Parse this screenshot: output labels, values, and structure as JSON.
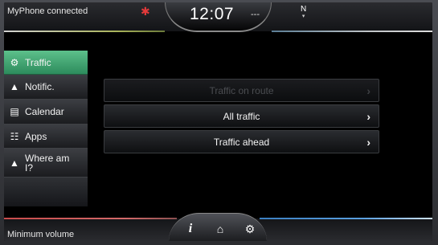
{
  "status_bar": {
    "connection": "MyPhone connected",
    "time": "12:07",
    "signal": "---",
    "compass": "N"
  },
  "sidebar": {
    "items": [
      {
        "label": "Traffic",
        "icon": "traffic-icon",
        "active": true
      },
      {
        "label": "Notific.",
        "icon": "warning-icon",
        "active": false
      },
      {
        "label": "Calendar",
        "icon": "calendar-icon",
        "active": false
      },
      {
        "label": "Apps",
        "icon": "apps-icon",
        "active": false
      },
      {
        "label": "Where am I?",
        "icon": "location-arrow-icon",
        "active": false
      }
    ]
  },
  "main": {
    "buttons": [
      {
        "label": "Traffic on route",
        "enabled": false
      },
      {
        "label": "All traffic",
        "enabled": true
      },
      {
        "label": "Traffic ahead",
        "enabled": true
      }
    ]
  },
  "bottom_bar": {
    "status": "Minimum volume",
    "icons": [
      "info-icon",
      "home-icon",
      "settings-icon"
    ]
  },
  "colors": {
    "active_tab": "#3fa873",
    "top_accent_left": "#d2d2d2",
    "bottom_accent_left": "#c84b4b",
    "bottom_accent_right": "#3b7fc1"
  }
}
